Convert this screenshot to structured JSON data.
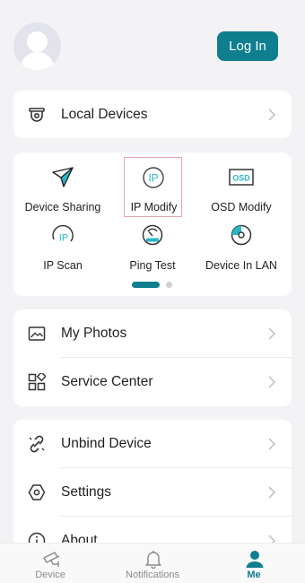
{
  "header": {
    "login_label": "Log In"
  },
  "local_devices": {
    "label": "Local Devices",
    "icon": "camera-icon"
  },
  "tools": [
    {
      "label": "Device Sharing",
      "icon": "paper-plane-icon"
    },
    {
      "label": "IP Modify",
      "icon": "ip-circle-icon",
      "selected": true
    },
    {
      "label": "OSD Modify",
      "icon": "osd-box-icon"
    },
    {
      "label": "IP Scan",
      "icon": "ip-scan-icon"
    },
    {
      "label": "Ping Test",
      "icon": "speedometer-icon"
    },
    {
      "label": "Device In LAN",
      "icon": "radar-icon"
    }
  ],
  "pager": {
    "pages": 2,
    "current": 1
  },
  "menu_group_1": [
    {
      "label": "My Photos",
      "icon": "photo-icon"
    },
    {
      "label": "Service Center",
      "icon": "grid-apps-icon"
    }
  ],
  "menu_group_2": [
    {
      "label": "Unbind Device",
      "icon": "broken-link-icon"
    },
    {
      "label": "Settings",
      "icon": "hexagon-settings-icon"
    },
    {
      "label": "About",
      "icon": "info-icon"
    }
  ],
  "bottom_nav": [
    {
      "label": "Device",
      "icon": "cctv-camera-icon"
    },
    {
      "label": "Notifications",
      "icon": "bell-icon"
    },
    {
      "label": "Me",
      "icon": "person-icon",
      "active": true
    }
  ],
  "colors": {
    "accent": "#0f7e8e",
    "background": "#f3f3f6",
    "selection_border": "#e8a3ab"
  }
}
